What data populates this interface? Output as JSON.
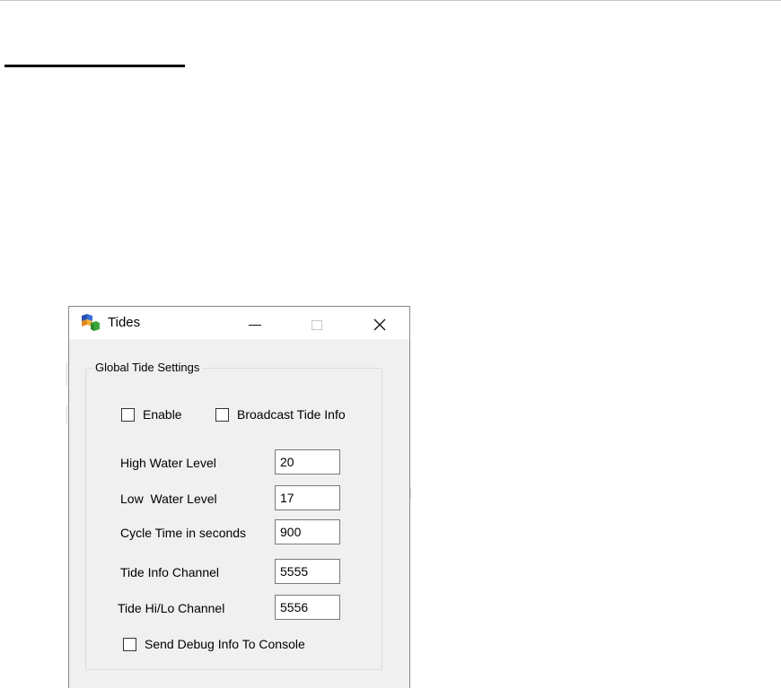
{
  "window": {
    "title": "Tides",
    "minimize_icon": "minimize-icon",
    "maximize_icon": "maximize-icon",
    "close_icon": "close-icon",
    "close_glyph": "✕",
    "app_icon": "app-cubes-icon"
  },
  "group": {
    "label": "Global Tide Settings",
    "enable": {
      "label": "Enable",
      "checked": false
    },
    "broadcast": {
      "label": "Broadcast Tide Info",
      "checked": false
    },
    "fields": [
      {
        "label": "High Water Level",
        "value": "20"
      },
      {
        "label": "Low  Water Level",
        "value": "17"
      },
      {
        "label": "Cycle Time in seconds",
        "value": "900"
      },
      {
        "label": "Tide Info Channel",
        "value": "5555"
      },
      {
        "label": "Tide Hi/Lo Channel",
        "value": "5556"
      }
    ],
    "debug": {
      "label": "Send Debug Info To Console",
      "checked": false
    }
  }
}
